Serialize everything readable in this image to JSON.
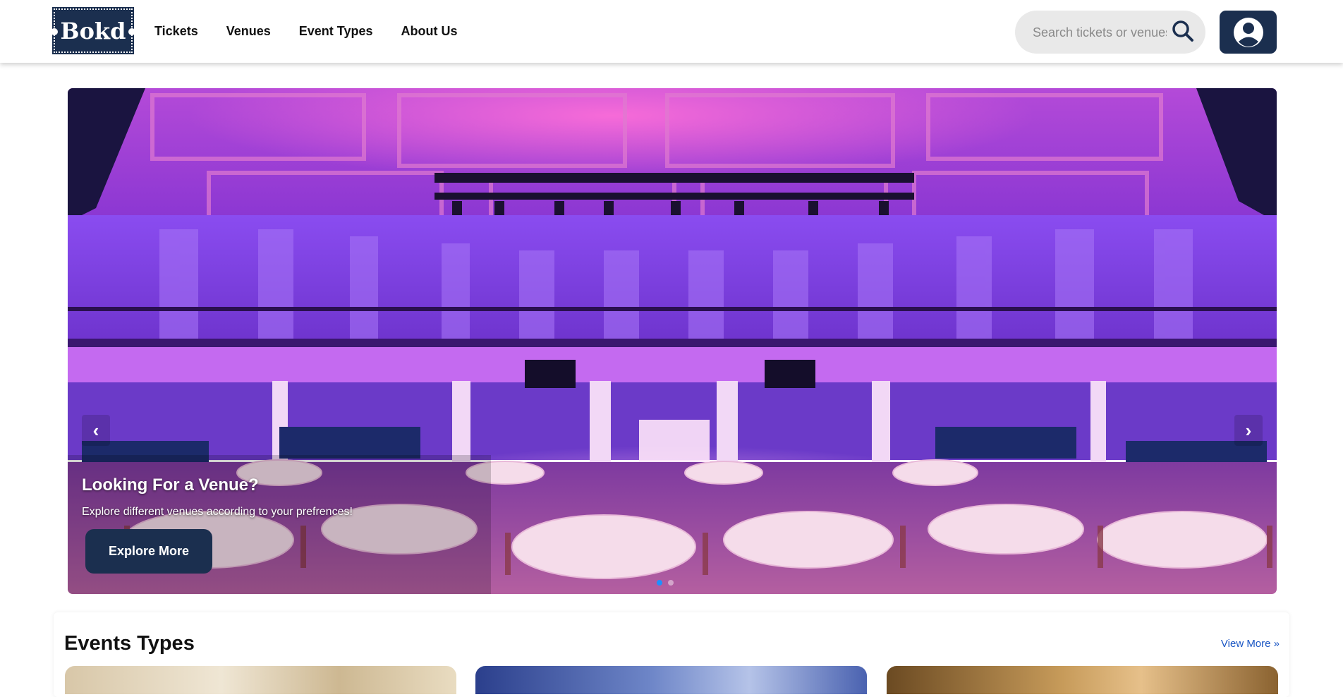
{
  "brand": {
    "logo_text": "Bokd"
  },
  "nav": [
    {
      "label": "Tickets"
    },
    {
      "label": "Venues"
    },
    {
      "label": "Event Types"
    },
    {
      "label": "About Us"
    }
  ],
  "search": {
    "placeholder": "Search tickets or venues",
    "icon": "search-icon"
  },
  "profile": {
    "icon": "user-avatar-icon"
  },
  "hero": {
    "title": "Looking For a Venue?",
    "subtitle": "Explore different venues according to your prefrences!",
    "button_label": "Explore More",
    "prev_label": "‹",
    "next_label": "›",
    "slide_count": 2,
    "active_slide": 0
  },
  "events": {
    "title": "Events Types",
    "view_more_label": "View More »"
  },
  "colors": {
    "brand_navy": "#1b2f4f",
    "link_blue": "#1a56c4",
    "active_dot": "#1e90ff"
  }
}
